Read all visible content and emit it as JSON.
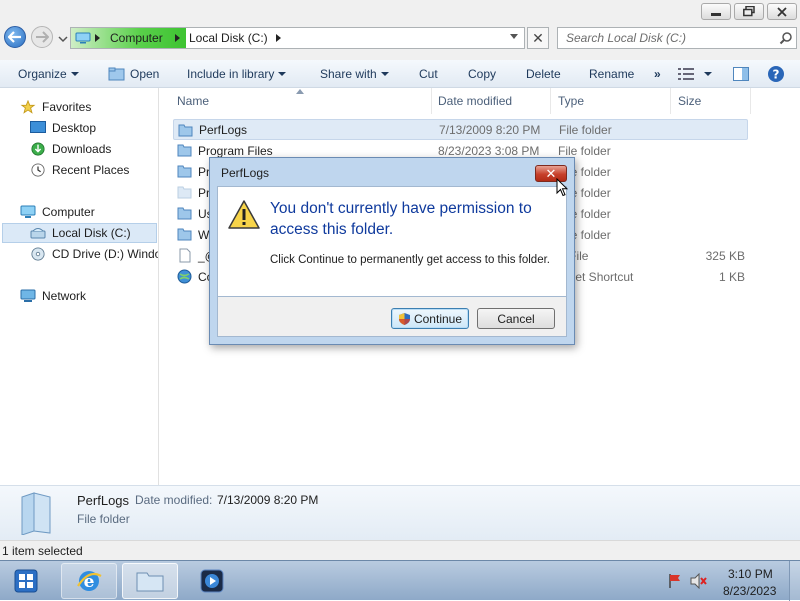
{
  "window": {
    "controls": [
      "minimize",
      "restore",
      "close"
    ]
  },
  "address": {
    "crumbs": [
      "Computer",
      "Local Disk (C:)"
    ],
    "close_glyph": "✕"
  },
  "search": {
    "placeholder": "Search Local Disk (C:)"
  },
  "toolbar": {
    "organize": "Organize",
    "open": "Open",
    "include": "Include in library",
    "share": "Share with",
    "cut": "Cut",
    "copy": "Copy",
    "delete": "Delete",
    "rename": "Rename",
    "more": "»"
  },
  "nav": {
    "favorites": "Favorites",
    "desktop": "Desktop",
    "downloads": "Downloads",
    "recent": "Recent Places",
    "computer": "Computer",
    "local_disk": "Local Disk (C:)",
    "cd_drive": "CD Drive (D:) Windo",
    "network": "Network"
  },
  "columns": {
    "name": "Name",
    "date": "Date modified",
    "type": "Type",
    "size": "Size"
  },
  "files": [
    {
      "name": "PerfLogs",
      "date": "7/13/2009 8:20 PM",
      "type": "File folder",
      "size": ""
    },
    {
      "name": "Program Files",
      "date": "8/23/2023 3:08 PM",
      "type": "File folder",
      "size": ""
    },
    {
      "name": "Pr",
      "date": "",
      "type": "File folder",
      "size": ""
    },
    {
      "name": "Pr",
      "date": "",
      "type": "File folder",
      "size": ""
    },
    {
      "name": "Us",
      "date": "",
      "type": "File folder",
      "size": ""
    },
    {
      "name": "W",
      "date": "",
      "type": "File folder",
      "size": ""
    },
    {
      "name": "_@",
      "date": "",
      "type": "P File",
      "size": "325 KB"
    },
    {
      "name": "Co",
      "date": "",
      "type": "ernet Shortcut",
      "size": "1 KB"
    }
  ],
  "details": {
    "name": "PerfLogs",
    "date_label": "Date modified:",
    "date": "7/13/2009 8:20 PM",
    "type": "File folder"
  },
  "status": {
    "text": "1 item selected"
  },
  "dialog": {
    "title": "PerfLogs",
    "close_glyph": "✕",
    "heading": "You don't currently have permission to access this folder.",
    "message": "Click Continue to permanently get access to this folder.",
    "continue": "Continue",
    "cancel": "Cancel"
  },
  "taskbar": {
    "time": "3:10 PM",
    "date": "8/23/2023"
  },
  "colors": {
    "accent": "#0f3a9d",
    "address_green": "#3ec332",
    "close_red": "#c7402b"
  }
}
